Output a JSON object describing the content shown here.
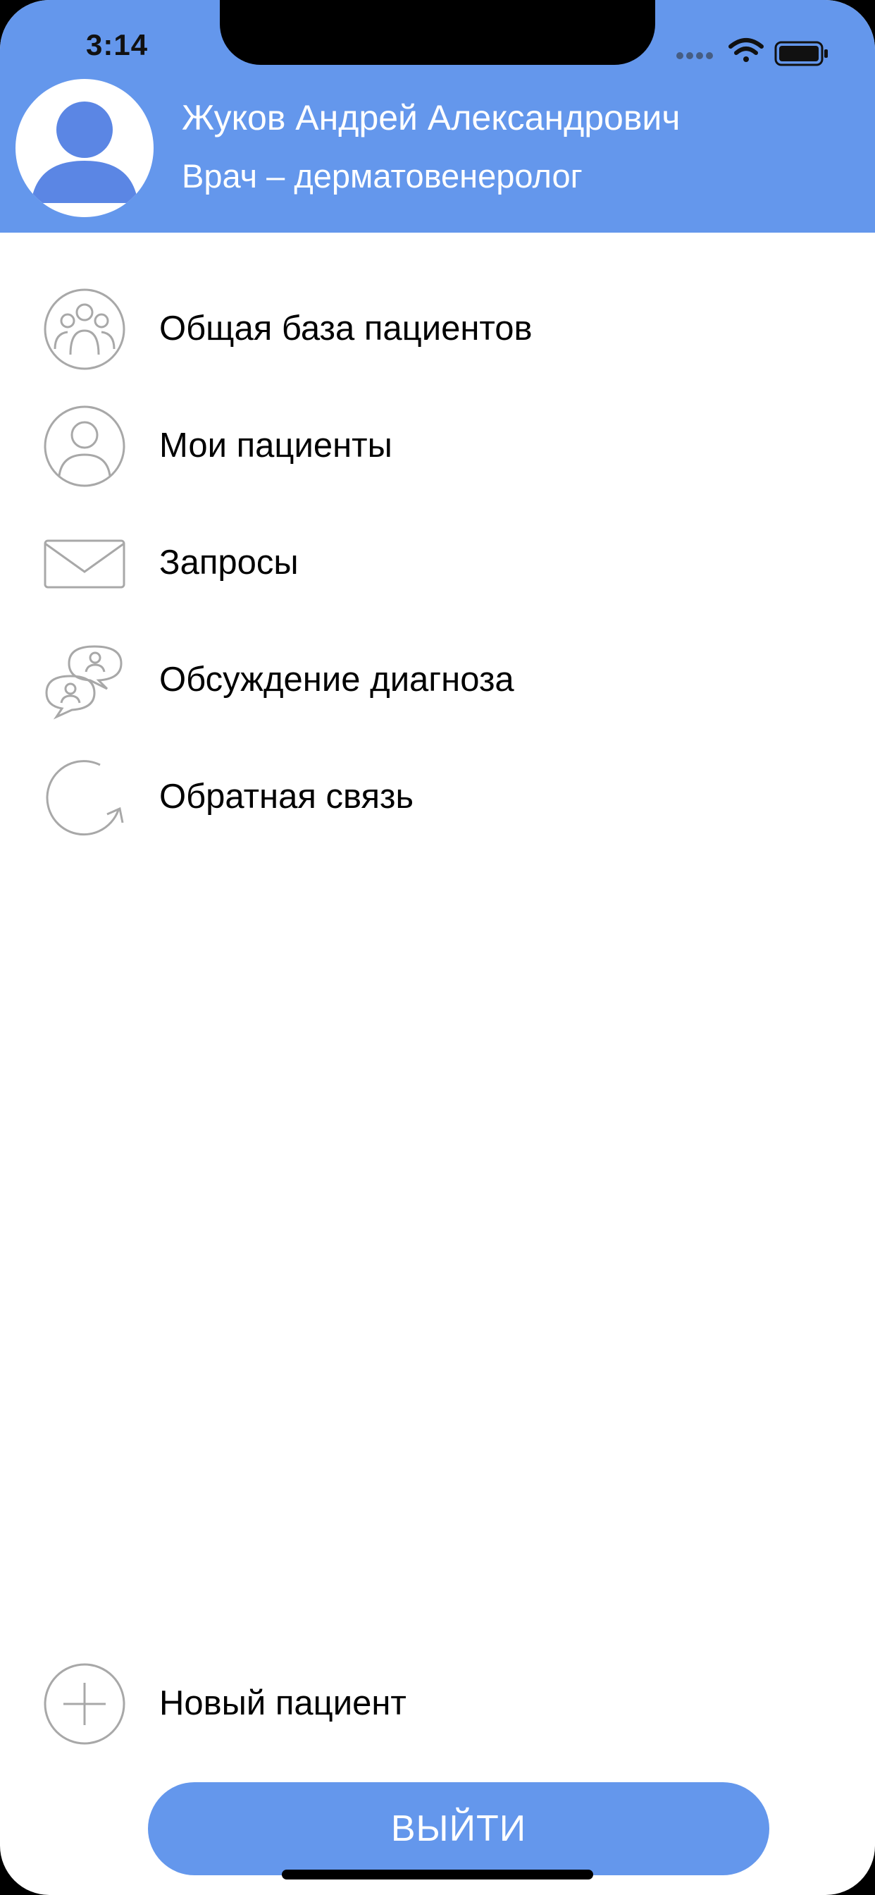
{
  "status_bar": {
    "time": "3:14"
  },
  "profile": {
    "name": "Жуков Андрей Александрович",
    "role": "Врач – дерматовенеролог"
  },
  "menu": {
    "items": [
      {
        "label": "Общая база пациентов",
        "icon": "group-icon"
      },
      {
        "label": "Мои пациенты",
        "icon": "user-icon"
      },
      {
        "label": "Запросы",
        "icon": "envelope-icon"
      },
      {
        "label": "Обсуждение диагноза",
        "icon": "chat-bubbles-icon"
      },
      {
        "label": "Обратная связь",
        "icon": "refresh-icon"
      }
    ],
    "new_patient": {
      "label": "Новый пациент",
      "icon": "plus-icon"
    }
  },
  "logout": {
    "label": "ВЫЙТИ"
  },
  "colors": {
    "accent": "#6497ec",
    "icon_gray": "#a8a8a8",
    "avatar_figure": "#5b86e4"
  }
}
